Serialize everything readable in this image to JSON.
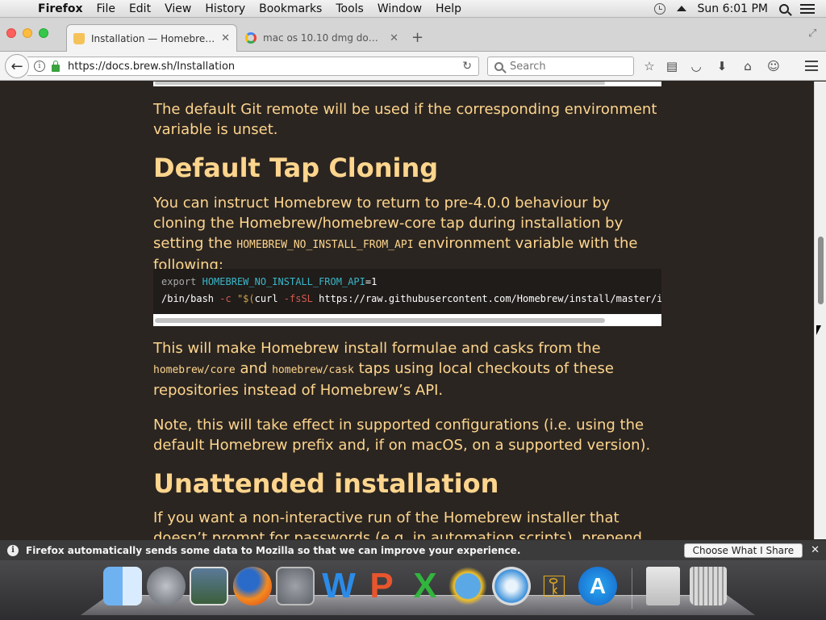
{
  "menubar": {
    "app": "Firefox",
    "items": [
      "File",
      "Edit",
      "View",
      "History",
      "Bookmarks",
      "Tools",
      "Window",
      "Help"
    ],
    "clock": "Sun 6:01 PM"
  },
  "tabs": [
    {
      "label": "Installation — Homebrew ...",
      "icon": "homebrew-favicon"
    },
    {
      "label": "mac os 10.10 dmg downl...",
      "icon": "google-favicon"
    }
  ],
  "navbar": {
    "url": "https://docs.brew.sh/Installation",
    "search_placeholder": "Search"
  },
  "page": {
    "para_git_remote": "The default Git remote will be used if the corresponding environment variable is unset.",
    "heading_tap": "Default Tap Cloning",
    "para_tap_1": "You can instruct Homebrew to return to pre-4.0.0 behaviour by cloning the Homebrew/homebrew-core tap during installation by setting the",
    "para_tap_code": "HOMEBREW_NO_INSTALL_FROM_API",
    "para_tap_2": "environment variable with the following:",
    "code_line1_kw": "export",
    "code_line1_var": "HOMEBREW_NO_INSTALL_FROM_API",
    "code_line1_val": "=1",
    "code_line2_cmd": "/bin/bash",
    "code_line2_flag": "-c",
    "code_line2_str": "\"$(",
    "code_line2_curl": "curl",
    "code_line2_flag2": "-fsSL",
    "code_line2_url": "https://raw.githubusercontent.com/Homebrew/install/master/install.sh",
    "para_make_1": "This will make Homebrew install formulae and casks from the",
    "para_make_code1": "homebrew/core",
    "para_make_and": "and",
    "para_make_code2": "homebrew/cask",
    "para_make_2": "taps using local checkouts of these repositories instead of Homebrew’s API.",
    "para_note": "Note, this will take effect in supported configurations (i.e. using the default Homebrew prefix and, if on macOS, on a supported version).",
    "heading_unattended": "Unattended installation",
    "para_unattended": "If you want a non-interactive run of the Homebrew installer that doesn’t prompt for passwords (e.g. in automation scripts), prepend"
  },
  "notification": {
    "text": "Firefox automatically sends some data to Mozilla so that we can improve your experience.",
    "button": "Choose What I Share"
  },
  "dock": [
    "Finder",
    "Launchpad",
    "Image Capture",
    "Firefox",
    "System Preferences",
    "Word",
    "PowerPoint",
    "Excel",
    "Weather",
    "Safari",
    "Keychain Access",
    "App Store",
    "Documents",
    "Trash"
  ],
  "colors": {
    "page_bg": "#2b2521",
    "text": "#fdd58d"
  }
}
